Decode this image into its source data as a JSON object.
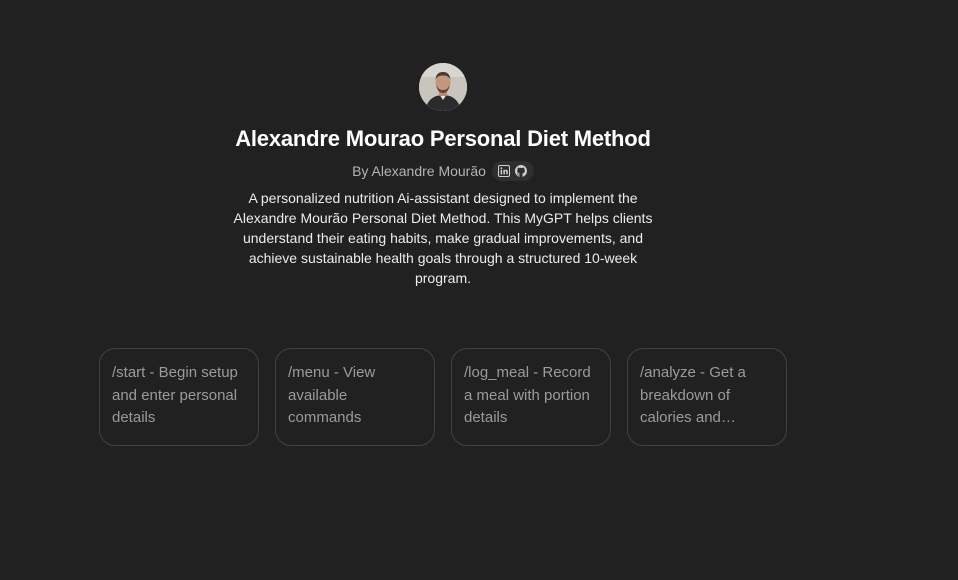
{
  "gpt": {
    "title": "Alexandre Mourao Personal Diet Method",
    "byline": "By Alexandre Mourão",
    "description": "A personalized nutrition Ai-assistant designed to implement the Alexandre Mourão Personal Diet Method. This MyGPT helps clients understand their eating habits, make gradual improvements, and achieve sustainable health goals through a structured 10-week program."
  },
  "social_links": [
    {
      "icon": "linkedin-icon"
    },
    {
      "icon": "github-icon"
    }
  ],
  "starters": [
    {
      "label": "/start - Begin setup and enter personal details"
    },
    {
      "label": "/menu - View available commands"
    },
    {
      "label": "/log_meal - Record a meal with portion details"
    },
    {
      "label": "/analyze - Get a breakdown of calories and macronutrients"
    }
  ],
  "colors": {
    "background": "#212121",
    "title": "#ffffff",
    "card_border": "#424242",
    "card_text": "#9b9b9b"
  }
}
